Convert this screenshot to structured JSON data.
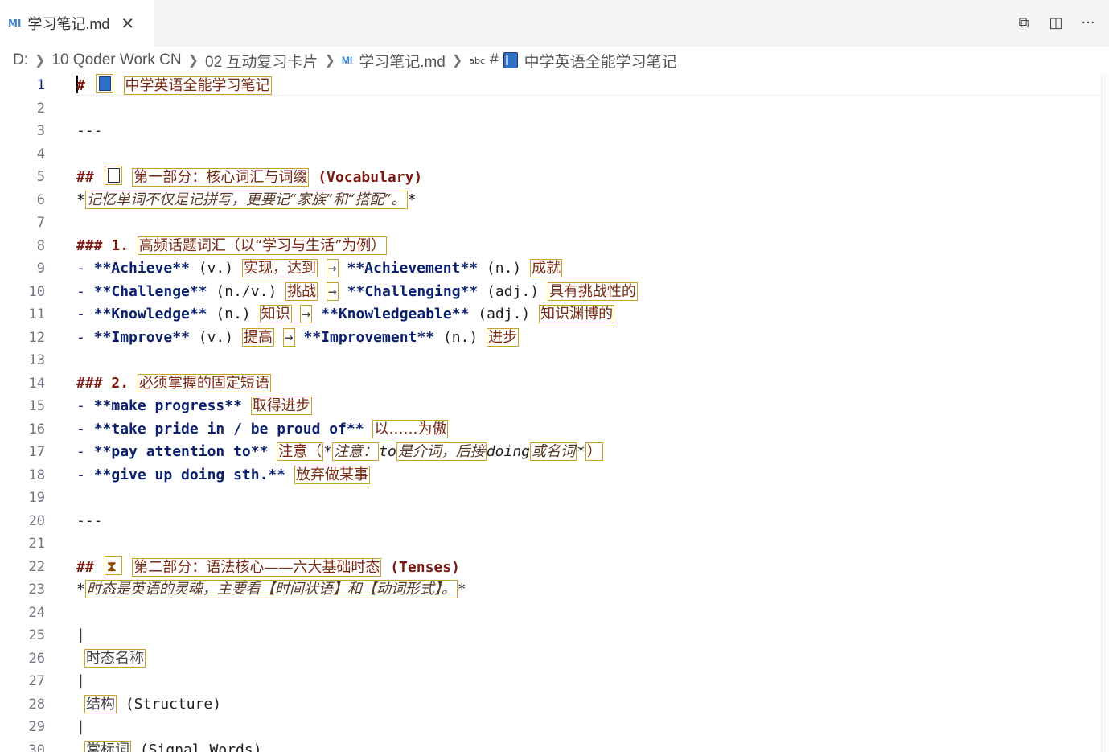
{
  "tab": {
    "icon": "MI",
    "title": "学习笔记.md",
    "close": "✕"
  },
  "toolbar": {
    "open_changes_icon": "⧉",
    "split_icon": "◫",
    "more_icon": "···"
  },
  "breadcrumb": {
    "items": [
      "D:",
      "10 Qoder Work CN",
      "02 互动复习卡片"
    ],
    "file_icon": "MI",
    "file": "学习笔记.md",
    "symbol_icon": "abc",
    "hash": "#",
    "heading": "中学英语全能学习笔记"
  },
  "lines": {
    "l1": {
      "n": "1",
      "h": "#",
      "t": "中学英语全能学习笔记"
    },
    "l2": {
      "n": "2"
    },
    "l3": {
      "n": "3",
      "t": "---"
    },
    "l4": {
      "n": "4"
    },
    "l5": {
      "n": "5",
      "h": "##",
      "t": "第一部分：核心词汇与词缀",
      "en": "(Vocabulary)"
    },
    "l6": {
      "n": "6",
      "a": "*",
      "t": "记忆单词不仅是记拼写，更要记“家族”和“搭配”。",
      "b": "*"
    },
    "l7": {
      "n": "7"
    },
    "l8": {
      "n": "8",
      "h": "###",
      "num": "1.",
      "t": "高频话题词汇（以“学习与生活”为例）"
    },
    "l9": {
      "n": "9",
      "d": "-",
      "w1": "**Achieve**",
      "p1": "(v.)",
      "c1": "实现，达到",
      "ar": "→",
      "w2": "**Achievement**",
      "p2": "(n.)",
      "c2": "成就"
    },
    "l10": {
      "n": "10",
      "d": "-",
      "w1": "**Challenge**",
      "p1": "(n./v.)",
      "c1": "挑战",
      "ar": "→",
      "w2": "**Challenging**",
      "p2": "(adj.)",
      "c2": "具有挑战性的"
    },
    "l11": {
      "n": "11",
      "d": "-",
      "w1": "**Knowledge**",
      "p1": "(n.)",
      "c1": "知识",
      "ar": "→",
      "w2": "**Knowledgeable**",
      "p2": "(adj.)",
      "c2": "知识渊博的"
    },
    "l12": {
      "n": "12",
      "d": "-",
      "w1": "**Improve**",
      "p1": "(v.)",
      "c1": "提高",
      "ar": "→",
      "w2": "**Improvement**",
      "p2": "(n.)",
      "c2": "进步"
    },
    "l13": {
      "n": "13"
    },
    "l14": {
      "n": "14",
      "h": "###",
      "num": "2.",
      "t": "必须掌握的固定短语"
    },
    "l15": {
      "n": "15",
      "d": "-",
      "w1": "**make progress**",
      "c1": "取得进步"
    },
    "l16": {
      "n": "16",
      "d": "-",
      "w1": "**take pride in / be proud of**",
      "c1": "以……为傲"
    },
    "l17": {
      "n": "17",
      "d": "-",
      "w1": "**pay attention to**",
      "c1": "注意（",
      "a": "*",
      "i1": "注意：",
      "to": "to",
      "i2": "是介词，后接",
      "doing": "doing",
      "i3": "或名词",
      "b": "*",
      "c2": "）"
    },
    "l18": {
      "n": "18",
      "d": "-",
      "w1": "**give up doing sth.**",
      "c1": "放弃做某事"
    },
    "l19": {
      "n": "19"
    },
    "l20": {
      "n": "20",
      "t": "---"
    },
    "l21": {
      "n": "21"
    },
    "l22": {
      "n": "22",
      "h": "##",
      "t": "第二部分：语法核心——六大基础时态",
      "en": "(Tenses)"
    },
    "l23": {
      "n": "23",
      "a": "*",
      "t": "时态是英语的灵魂，主要看【时间状语】和【动词形式】。",
      "b": "*"
    },
    "l24": {
      "n": "24"
    },
    "l25": {
      "n": "25",
      "p": "|"
    },
    "l26": {
      "n": "26",
      "t": "时态名称"
    },
    "l27": {
      "n": "27",
      "p": "|"
    },
    "l28": {
      "n": "28",
      "t": "结构",
      "en": "(Structure)"
    },
    "l29": {
      "n": "29",
      "p": "|"
    },
    "l30": {
      "n": "30",
      "t": "常标词",
      "en": "(Signal Words)"
    }
  }
}
